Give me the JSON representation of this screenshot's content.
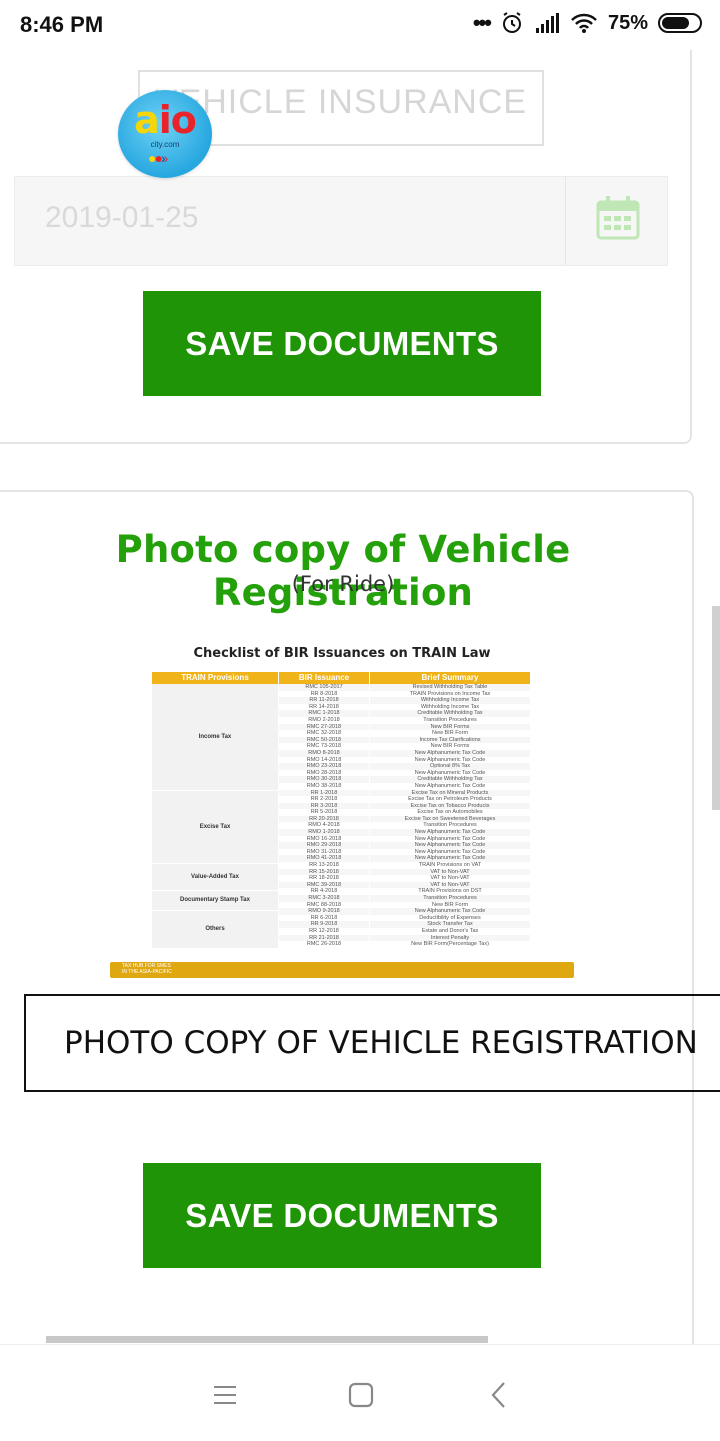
{
  "status_bar": {
    "time": "8:46 PM",
    "dots": "•••",
    "battery_percent": "75%",
    "battery_level": 0.75,
    "icons": [
      "alarm-icon",
      "signal-icon",
      "wifi-icon",
      "battery-icon"
    ]
  },
  "top_card": {
    "section_title": "VEHICLE INSURANCE",
    "date_value": "2019-01-25",
    "calendar_icon": "calendar-icon",
    "logo_text": "aio",
    "logo_sub": "city.com",
    "save_label": "SAVE DOCUMENTS"
  },
  "main_card": {
    "heading": "Photo copy of Vehicle Registration",
    "subheading": "(For Ride)",
    "document": {
      "title": "Checklist of BIR Issuances on TRAIN Law",
      "columns": [
        "TRAIN Provisions",
        "BIR Issuance",
        "Brief Summary"
      ],
      "categories": [
        "Income Tax",
        "Excise Tax",
        "Value-Added Tax",
        "Documentary Stamp Tax",
        "Others"
      ],
      "rows": [
        [
          "RMC 105-2017",
          "Revised Withholding Tax Table"
        ],
        [
          "RR 8-2018",
          "TRAIN Provisions on Income Tax"
        ],
        [
          "RR 11-2018",
          "Withholding Income Tax"
        ],
        [
          "RR 14-2018",
          "Withholding Income Tax"
        ],
        [
          "RMC 1-2018",
          "Creditable Withholding Tax"
        ],
        [
          "RMO 2-2018",
          "Transition Procedures"
        ],
        [
          "RMC 27-2018",
          "New BIR Forms"
        ],
        [
          "RMC 32-2018",
          "New BIR Form"
        ],
        [
          "RMC 50-2018",
          "Income Tax Clarifications"
        ],
        [
          "RMC 73-2018",
          "New BIR Forms"
        ],
        [
          "RMO 8-2018",
          "New Alphanumeric Tax Code"
        ],
        [
          "RMO 14-2018",
          "New Alphanumeric Tax Code"
        ],
        [
          "RMO 23-2018",
          "Optional 8% Tax"
        ],
        [
          "RMO 28-2018",
          "New Alphanumeric Tax Code"
        ],
        [
          "RMO 30-2018",
          "Creditable Withholding Tax"
        ],
        [
          "RMO 38-2018",
          "New Alphanumeric Tax Code"
        ],
        [
          "RR 1-2018",
          "Excise Tax on Mineral Products"
        ],
        [
          "RR 2-2018",
          "Excise Tax on Petroleum Products"
        ],
        [
          "RR 3-2018",
          "Excise Tax on Tobacco Products"
        ],
        [
          "RR 5-2018",
          "Excise Tax on Automobiles"
        ],
        [
          "RR 20-2018",
          "Excise Tax on Sweetened Beverages"
        ],
        [
          "RMO 4-2018",
          "Transition Procedures"
        ],
        [
          "RMO 1-2018",
          "New Alphanumeric Tax Code"
        ],
        [
          "RMO 16-2018",
          "New Alphanumeric Tax Code"
        ],
        [
          "RMO 29-2018",
          "New Alphanumeric Tax Code"
        ],
        [
          "RMO 31-2018",
          "New Alphanumeric Tax Code"
        ],
        [
          "RMO 41-2018",
          "New Alphanumeric Tax Code"
        ],
        [
          "RR 13-2018",
          "TRAIN Provisions on VAT"
        ],
        [
          "RR 15-2018",
          "VAT to Non-VAT"
        ],
        [
          "RR 18-2018",
          "VAT to Non-VAT"
        ],
        [
          "RMC 39-2018",
          "VAT to Non-VAT"
        ],
        [
          "RR 4-2018",
          "TRAIN Provisions on DST"
        ],
        [
          "RMC 3-2018",
          "Transition Procedures"
        ],
        [
          "RMC 88-2018",
          "New BIR Form"
        ],
        [
          "RMO 9-2018",
          "New Alphanumeric Tax Code"
        ],
        [
          "RR 6-2018",
          "Deductibility of Expenses"
        ],
        [
          "RR 9-2018",
          "Stock Transfer Tax"
        ],
        [
          "RR 12-2018",
          "Estate and Donor's Tax"
        ],
        [
          "RR 21-2018",
          "Interest Penalty"
        ],
        [
          "RMC 26-2018",
          "New BIR Form(Percentage Tax)"
        ]
      ],
      "footer_line1": "TAX HUB FOR SMES",
      "footer_line2": "IN THE ASIA-PACIFIC"
    },
    "registration_field_value": "PHOTO COPY OF VEHICLE REGISTRATION",
    "save_label": "SAVE DOCUMENTS"
  },
  "nav_bar": {
    "icons": [
      "menu-icon",
      "home-icon",
      "back-icon"
    ]
  },
  "colors": {
    "accent_green": "#1e9406",
    "heading_green": "#24a00a",
    "doc_header": "#f0b31a"
  }
}
